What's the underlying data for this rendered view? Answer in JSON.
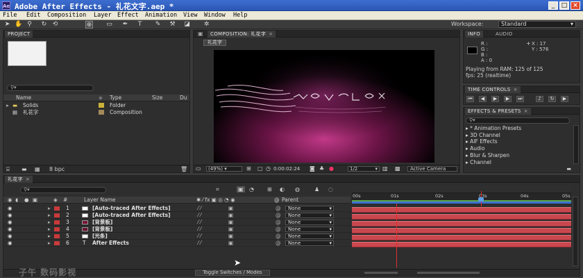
{
  "window": {
    "app_icon": "Ae",
    "title": "Adobe After Effects - 礼花文字.aep *",
    "controls": [
      "minimize-icon",
      "maximize-icon",
      "close-icon"
    ]
  },
  "menu": [
    "File",
    "Edit",
    "Composition",
    "Layer",
    "Effect",
    "Animation",
    "View",
    "Window",
    "Help"
  ],
  "toolbar": {
    "tools": [
      "selection-tool-icon",
      "hand-tool-icon",
      "zoom-tool-icon",
      "rotate-tool-icon",
      "orbit-camera-icon",
      "pan-behind-icon",
      "rectangle-tool-icon",
      "pen-tool-icon",
      "text-tool-icon",
      "brush-tool-icon",
      "clone-stamp-icon",
      "eraser-tool-icon",
      "puppet-pin-icon"
    ],
    "workspace_label": "Workspace:",
    "workspace_value": "Standard"
  },
  "project": {
    "tab": "PROJECT",
    "columns": [
      "Name",
      "Type",
      "Size",
      "Du"
    ],
    "items": [
      {
        "name": "Solids",
        "type": "Folder",
        "swatch": "#c9b23a"
      },
      {
        "name": "礼花字",
        "type": "Composition",
        "swatch": "#a38a5c"
      }
    ],
    "bpc": "8 bpc"
  },
  "composition": {
    "tab": "COMPOSITION: 礼花字",
    "crumb": "礼花字",
    "zoom": "(49%)",
    "timecode": "0:00:02:24",
    "resolution": "1/2",
    "camera": "Active Camera"
  },
  "info": {
    "tabs": [
      "INFO",
      "AUDIO"
    ],
    "r": "R :",
    "g": "G :",
    "b": "B :",
    "a": "A : 0",
    "x": "X : 17",
    "y": "Y : 576",
    "playing": "Playing from RAM: 125 of 125",
    "fps": "fps: 25 (realtime)"
  },
  "time_controls": {
    "tab": "TIME CONTROLS",
    "buttons": [
      "first-frame-icon",
      "prev-frame-icon",
      "play-icon",
      "next-frame-icon",
      "last-frame-icon",
      "audio-icon",
      "loop-icon",
      "ram-preview-icon"
    ]
  },
  "effects": {
    "tab": "EFFECTS & PRESETS",
    "items": [
      "* Animation Presets",
      "3D Channel",
      "AIF Effects",
      "Audio",
      "Blur & Sharpen",
      "Channel"
    ]
  },
  "timeline": {
    "tab": "礼花字",
    "col_layer_name": "Layer Name",
    "col_parent": "Parent",
    "ticks": [
      "00s",
      "01s",
      "02s",
      "03s",
      "04s",
      "05s"
    ],
    "layers": [
      {
        "num": "1",
        "name": "[Auto-traced After Effects]",
        "color": "#ffffff",
        "parent": "None"
      },
      {
        "num": "2",
        "name": "[Auto-traced After Effects]",
        "color": "#ffffff",
        "parent": "None"
      },
      {
        "num": "3",
        "name": "[背景板]",
        "color": "#7a1236",
        "parent": "None"
      },
      {
        "num": "4",
        "name": "[背景板]",
        "color": "#6a1030",
        "parent": "None"
      },
      {
        "num": "5",
        "name": "[光条]",
        "color": "#ffffff",
        "parent": "None"
      },
      {
        "num": "6",
        "name": "After Effects",
        "color": "",
        "parent": "None"
      }
    ],
    "toggle_label": "Toggle Switches / Modes",
    "watermark": "子午  数码影视"
  },
  "colors": {
    "accent": "#c9474e",
    "playhead": "#e03030",
    "work_area": "#3d6fd0"
  }
}
